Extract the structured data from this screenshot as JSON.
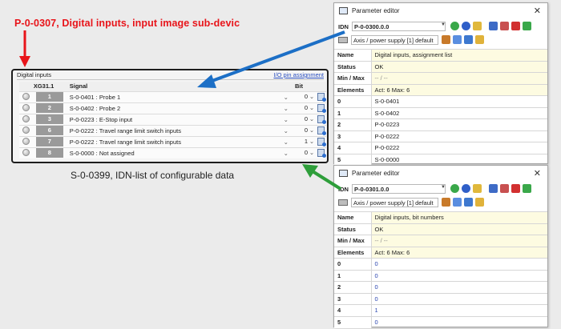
{
  "annotation": {
    "title": "P-0-0307, Digital inputs, input image sub-devic",
    "caption": "S-0-0399, IDN-list of configurable data"
  },
  "digital_inputs": {
    "title": "Digital inputs",
    "link": "I/O pin assignment",
    "headers": {
      "pin": "XG31.1",
      "signal": "Signal",
      "bit": "Bit"
    },
    "rows": [
      {
        "pin": "1",
        "signal": "S-0-0401 :  Probe 1",
        "bit": "0"
      },
      {
        "pin": "2",
        "signal": "S-0-0402 :  Probe 2",
        "bit": "0"
      },
      {
        "pin": "3",
        "signal": "P-0-0223 :  E-Stop input",
        "bit": "0"
      },
      {
        "pin": "6",
        "signal": "P-0-0222 :  Travel range limit switch inputs",
        "bit": "0"
      },
      {
        "pin": "7",
        "signal": "P-0-0222 :  Travel range limit switch inputs",
        "bit": "1"
      },
      {
        "pin": "8",
        "signal": "S-0-0000 :  Not assigned",
        "bit": "0"
      }
    ]
  },
  "editor1": {
    "title": "Parameter editor",
    "idn_label": "IDN",
    "idn": "P-0-0300.0.0",
    "axis": "Axis / power supply [1] default",
    "rows": [
      {
        "key": "Name",
        "value": "Digital inputs, assignment list"
      },
      {
        "key": "Status",
        "value": "OK"
      },
      {
        "key": "Min / Max",
        "value": "-- / --"
      },
      {
        "key": "Elements",
        "value": "Act: 6  Max: 6"
      },
      {
        "key": "0",
        "value": "S-0-0401"
      },
      {
        "key": "1",
        "value": "S-0-0402"
      },
      {
        "key": "2",
        "value": "P-0-0223"
      },
      {
        "key": "3",
        "value": "P-0-0222"
      },
      {
        "key": "4",
        "value": "P-0-0222"
      },
      {
        "key": "5",
        "value": "S-0-0000"
      }
    ]
  },
  "editor2": {
    "title": "Parameter editor",
    "idn_label": "IDN",
    "idn": "P-0-0301.0.0",
    "axis": "Axis / power supply [1] default",
    "rows": [
      {
        "key": "Name",
        "value": "Digital inputs, bit numbers"
      },
      {
        "key": "Status",
        "value": "OK"
      },
      {
        "key": "Min / Max",
        "value": "-- / --"
      },
      {
        "key": "Elements",
        "value": "Act: 6  Max: 6"
      },
      {
        "key": "0",
        "value": "0"
      },
      {
        "key": "1",
        "value": "0"
      },
      {
        "key": "2",
        "value": "0"
      },
      {
        "key": "3",
        "value": "0"
      },
      {
        "key": "4",
        "value": "1"
      },
      {
        "key": "5",
        "value": "0"
      }
    ]
  },
  "colors": {
    "annotation_red": "#e8141a",
    "arrow_red": "#e8141a",
    "arrow_blue": "#1c6fc6",
    "arrow_green": "#2e9e3a",
    "highlight_yellow": "#fdfbe1"
  }
}
